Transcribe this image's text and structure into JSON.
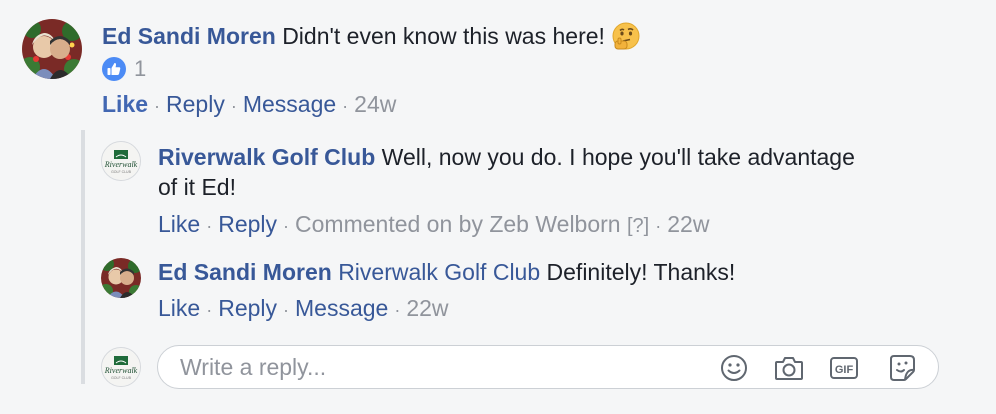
{
  "comment": {
    "author": "Ed Sandi Moren",
    "text": "Didn't even know this was here!",
    "emoji": "thinking-face-emoji",
    "reaction_count": "1",
    "actions": {
      "like": "Like",
      "reply": "Reply",
      "message": "Message",
      "time": "24w"
    }
  },
  "replies": [
    {
      "author": "Riverwalk Golf Club",
      "text_line1": "Well, now you do. I hope you'll take advantage",
      "text_line2": "of it Ed!",
      "actions": {
        "like": "Like",
        "reply": "Reply",
        "commented_by": "Commented on by Zeb Welborn",
        "help": "[?]",
        "time": "22w"
      }
    },
    {
      "author": "Ed Sandi Moren",
      "mention": "Riverwalk Golf Club",
      "text": "Definitely! Thanks!",
      "actions": {
        "like": "Like",
        "reply": "Reply",
        "message": "Message",
        "time": "22w"
      }
    }
  ],
  "reply_box": {
    "placeholder": "Write a reply...",
    "tools": [
      "emoji-icon",
      "camera-icon",
      "gif-icon",
      "sticker-icon"
    ]
  },
  "colors": {
    "background": "#f5f6f7",
    "name": "#385898",
    "like_active": "#4267b2",
    "muted": "#90949c"
  },
  "dot": "·"
}
